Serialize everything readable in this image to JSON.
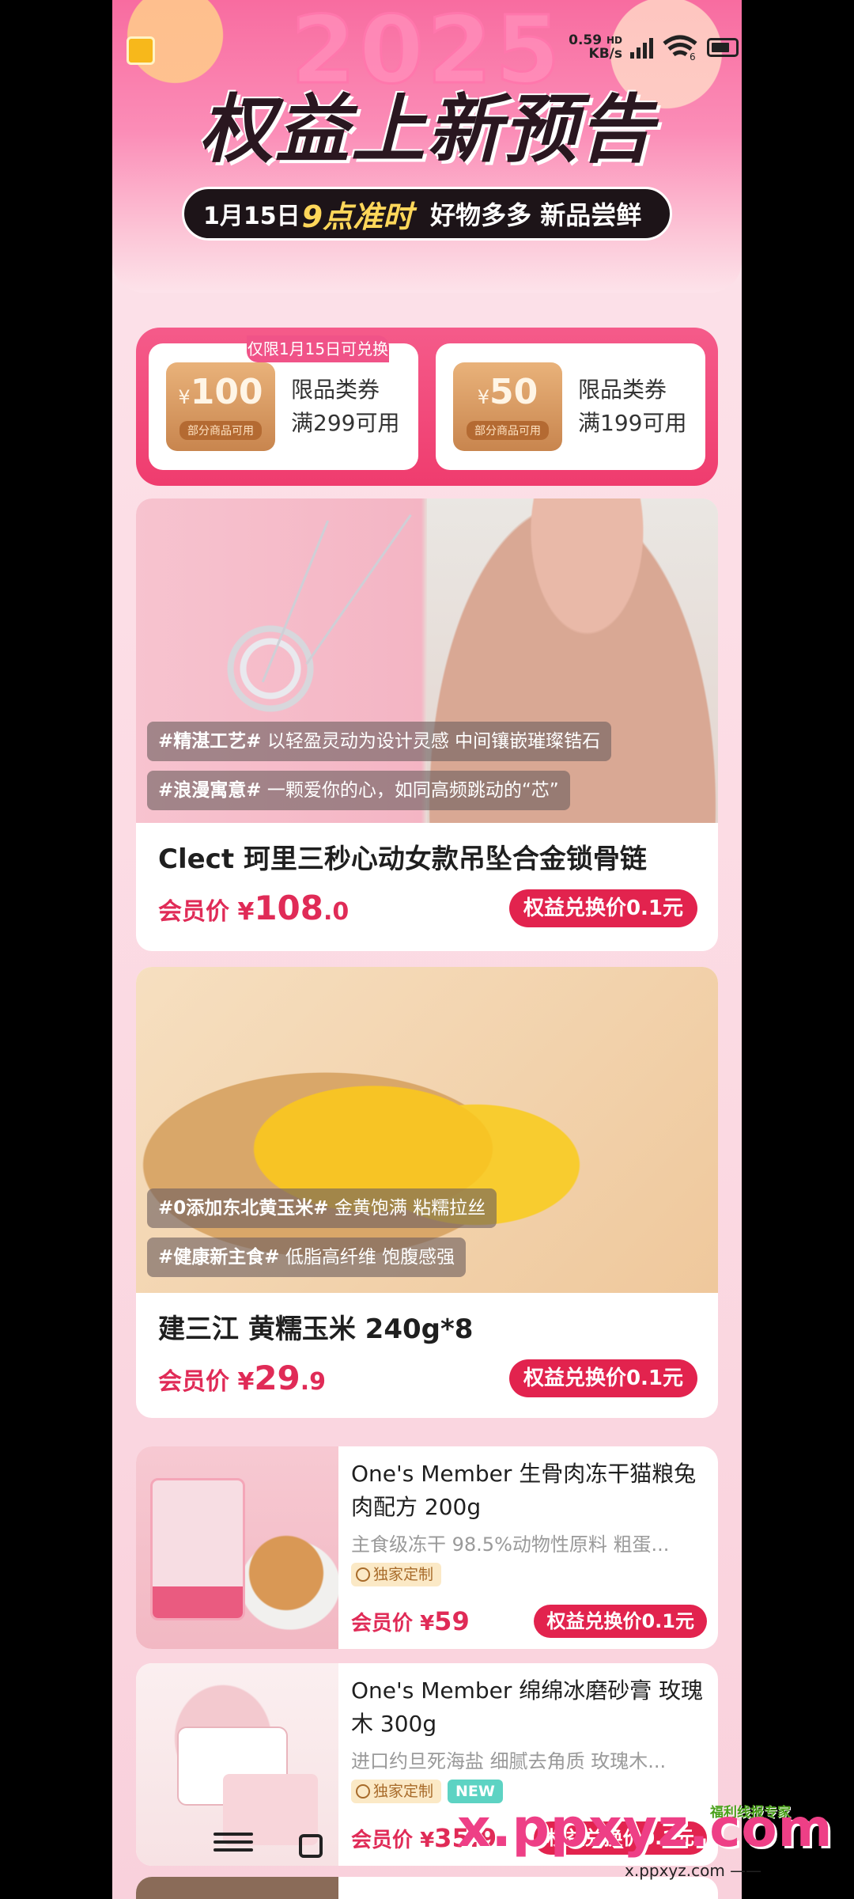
{
  "status_bar": {
    "net_speed": "0.59",
    "net_unit": "KB/s",
    "hd_label": "HD",
    "wifi_label": "6"
  },
  "banner": {
    "year": "2025",
    "title": "权益上新预告",
    "date": "1月15日",
    "time": "9点准时",
    "subtitle": "好物多多 新品尝鲜"
  },
  "coupons": {
    "limit_tag": "仅限1月15日可兑换",
    "items": [
      {
        "currency": "¥",
        "amount": "100",
        "note": "部分商品可用",
        "type": "限品类券",
        "condition": "满299可用"
      },
      {
        "currency": "¥",
        "amount": "50",
        "note": "部分商品可用",
        "type": "限品类券",
        "condition": "满199可用"
      }
    ]
  },
  "products": [
    {
      "tags": [
        {
          "hashtag": "#精湛工艺#",
          "text": "以轻盈灵动为设计灵感 中间镶嵌璀璨锆石"
        },
        {
          "hashtag": "#浪漫寓意#",
          "text": "一颗爱你的心，如同高频跳动的“芯”"
        }
      ],
      "title": "Clect 珂里三秒心动女款吊坠合金锁骨链",
      "price_label": "会员价",
      "currency": "¥",
      "price_int": "108",
      "price_dec": ".0",
      "redeem_label": "权益兑换价0.1元"
    },
    {
      "tags": [
        {
          "hashtag": "#0添加东北黄玉米#",
          "text": "金黄饱满 粘糯拉丝"
        },
        {
          "hashtag": "#健康新主食#",
          "text": "低脂高纤维 饱腹感强"
        }
      ],
      "title": "建三江 黄糯玉米 240g*8",
      "price_label": "会员价",
      "currency": "¥",
      "price_int": "29",
      "price_dec": ".9",
      "redeem_label": "权益兑换价0.1元"
    },
    {
      "title": "One's Member 生骨肉冻干猫粮兔肉配方 200g",
      "desc": "主食级冻干 98.5%动物性原料 粗蛋...",
      "badge_exclusive": "独家定制",
      "price_label": "会员价",
      "currency": "¥",
      "price_int": "59",
      "redeem_label": "权益兑换价0.1元"
    },
    {
      "title": "One's Member 绵绵冰磨砂膏 玫瑰木 300g",
      "desc": "进口约旦死海盐 细腻去角质 玫瑰木...",
      "badge_exclusive": "独家定制",
      "badge_new": "NEW",
      "price_label": "会员价",
      "currency": "¥",
      "price_int": "35.9",
      "redeem_label": "权益兑换价0.1元"
    }
  ],
  "watermark": {
    "top": "福利线报专家",
    "main": "x.ppxyz.com",
    "sub": "x.ppxyz.com ——"
  },
  "colors": {
    "accent": "#e2234e",
    "price": "#e02b57",
    "coupon_border": "#ef3c6e"
  }
}
